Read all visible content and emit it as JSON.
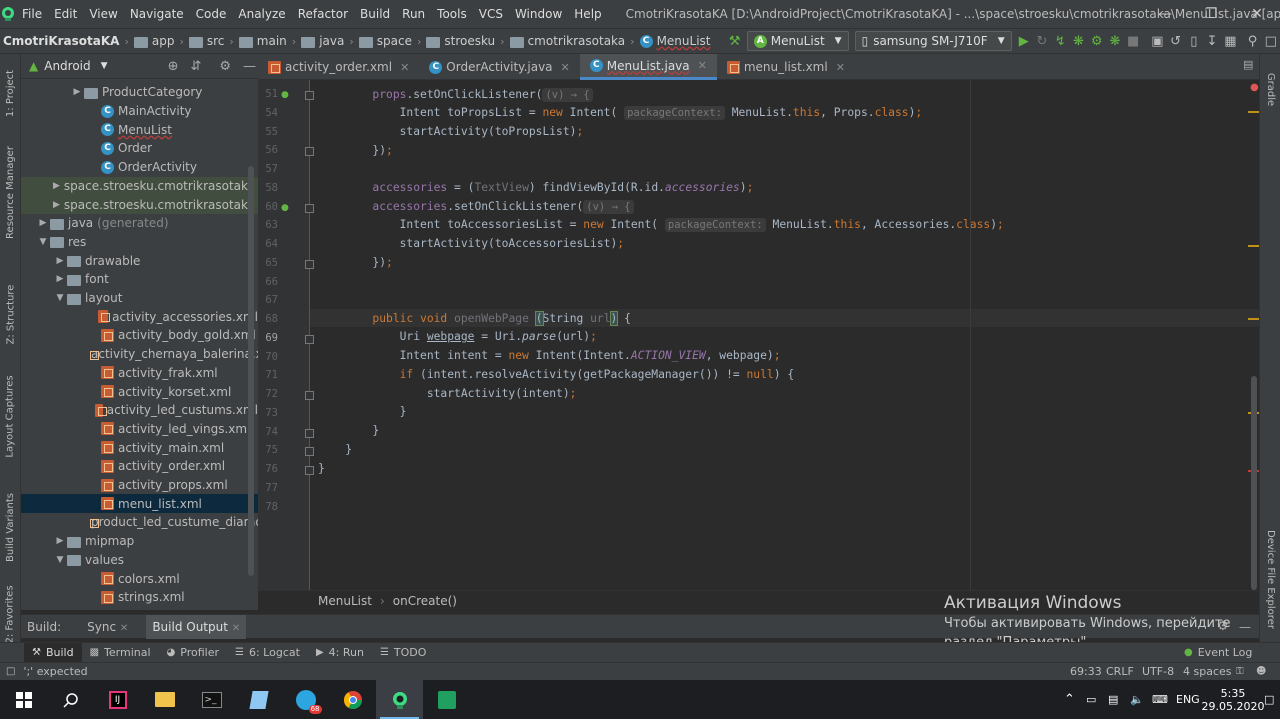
{
  "menubar": {
    "items": [
      "File",
      "Edit",
      "View",
      "Navigate",
      "Code",
      "Analyze",
      "Refactor",
      "Build",
      "Run",
      "Tools",
      "VCS",
      "Window",
      "Help"
    ],
    "title": "CmotriKrasotaKA [D:\\AndroidProject\\CmotriKrasotaKA] - ...\\space\\stroesku\\cmotrikrasotaka\\MenuList.java [app]"
  },
  "navbar": {
    "project": "CmotriKrasotaKA",
    "crumbs": [
      "app",
      "src",
      "main",
      "java",
      "space",
      "stroesku",
      "cmotrikrasotaka",
      "MenuList"
    ],
    "run_config": "MenuList",
    "device": "samsung SM-J710F"
  },
  "left_strip": {
    "tabs": [
      "1: Project",
      "Resource Manager",
      "Z: Structure",
      "Layout Captures",
      "Build Variants",
      "2: Favorites"
    ]
  },
  "right_strip": {
    "tabs": [
      "Gradle",
      "Device File Explorer"
    ]
  },
  "project_panel": {
    "view": "Android",
    "rows": [
      {
        "label": "ProductCategory",
        "indent": 3,
        "icon": "folder",
        "arrow": "▶"
      },
      {
        "label": "MainActivity",
        "indent": 4,
        "icon": "class"
      },
      {
        "label": "MenuList",
        "indent": 4,
        "icon": "class"
      },
      {
        "label": "Order",
        "indent": 4,
        "icon": "class"
      },
      {
        "label": "OrderActivity",
        "indent": 4,
        "icon": "class"
      },
      {
        "label": "space.stroesku.cmotrikrasotaka",
        "suffix": "(a",
        "indent": 2,
        "icon": "folder",
        "arrow": "▶",
        "hl": true
      },
      {
        "label": "space.stroesku.cmotrikrasotaka",
        "suffix": "(t",
        "indent": 2,
        "icon": "folder",
        "arrow": "▶",
        "hl": true
      },
      {
        "label": "java",
        "suffix": "(generated)",
        "indent": 1,
        "icon": "folder",
        "arrow": "▶"
      },
      {
        "label": "res",
        "indent": 1,
        "icon": "folder",
        "arrow": "▼"
      },
      {
        "label": "drawable",
        "indent": 2,
        "icon": "folder",
        "arrow": "▶"
      },
      {
        "label": "font",
        "indent": 2,
        "icon": "folder",
        "arrow": "▶"
      },
      {
        "label": "layout",
        "indent": 2,
        "icon": "folder",
        "arrow": "▼"
      },
      {
        "label": "activity_accessories.xml",
        "indent": 4,
        "icon": "xml"
      },
      {
        "label": "activity_body_gold.xml",
        "indent": 4,
        "icon": "xml"
      },
      {
        "label": "activity_chernaya_balerina.xml",
        "indent": 4,
        "icon": "xml"
      },
      {
        "label": "activity_frak.xml",
        "indent": 4,
        "icon": "xml"
      },
      {
        "label": "activity_korset.xml",
        "indent": 4,
        "icon": "xml"
      },
      {
        "label": "activity_led_custums.xml",
        "indent": 4,
        "icon": "xml"
      },
      {
        "label": "activity_led_vings.xml",
        "indent": 4,
        "icon": "xml"
      },
      {
        "label": "activity_main.xml",
        "indent": 4,
        "icon": "xml"
      },
      {
        "label": "activity_order.xml",
        "indent": 4,
        "icon": "xml"
      },
      {
        "label": "activity_props.xml",
        "indent": 4,
        "icon": "xml"
      },
      {
        "label": "menu_list.xml",
        "indent": 4,
        "icon": "xml",
        "sel": true
      },
      {
        "label": "product_led_custume_diamon",
        "indent": 4,
        "icon": "xml"
      },
      {
        "label": "mipmap",
        "indent": 2,
        "icon": "folder",
        "arrow": "▶"
      },
      {
        "label": "values",
        "indent": 2,
        "icon": "folder",
        "arrow": "▼"
      },
      {
        "label": "colors.xml",
        "indent": 4,
        "icon": "xml"
      },
      {
        "label": "strings.xml",
        "indent": 4,
        "icon": "xml"
      }
    ]
  },
  "tabs": [
    {
      "label": "activity_order.xml",
      "icon": "xml"
    },
    {
      "label": "OrderActivity.java",
      "icon": "class"
    },
    {
      "label": "MenuList.java",
      "icon": "class",
      "active": true
    },
    {
      "label": "menu_list.xml",
      "icon": "xml"
    }
  ],
  "editor": {
    "line_numbers": [
      "51",
      "54",
      "55",
      "56",
      "57",
      "58",
      "60",
      "63",
      "64",
      "65",
      "66",
      "67",
      "68",
      "69",
      "70",
      "71",
      "72",
      "73",
      "74",
      "75",
      "76",
      "77",
      "78"
    ],
    "current_line": "69"
  },
  "editor_breadcrumb": [
    "MenuList",
    "onCreate()"
  ],
  "build_bar": {
    "label": "Build:",
    "sync": "Sync",
    "output": "Build Output"
  },
  "tool_windows": [
    "Build",
    "Terminal",
    "Profiler",
    "6: Logcat",
    "4: Run",
    "TODO"
  ],
  "event_log": "Event Log",
  "status": {
    "message": "';' expected",
    "position": "69:33",
    "line_sep": "CRLF",
    "encoding": "UTF-8",
    "indent": "4 spaces"
  },
  "activation": {
    "title": "Активация Windows",
    "line1": "Чтобы активировать Windows, перейдите",
    "line2": "раздел \"Параметры\"."
  },
  "taskbar": {
    "lang": "ENG",
    "time": "5:35",
    "date": "29.05.2020",
    "badge": "68"
  }
}
